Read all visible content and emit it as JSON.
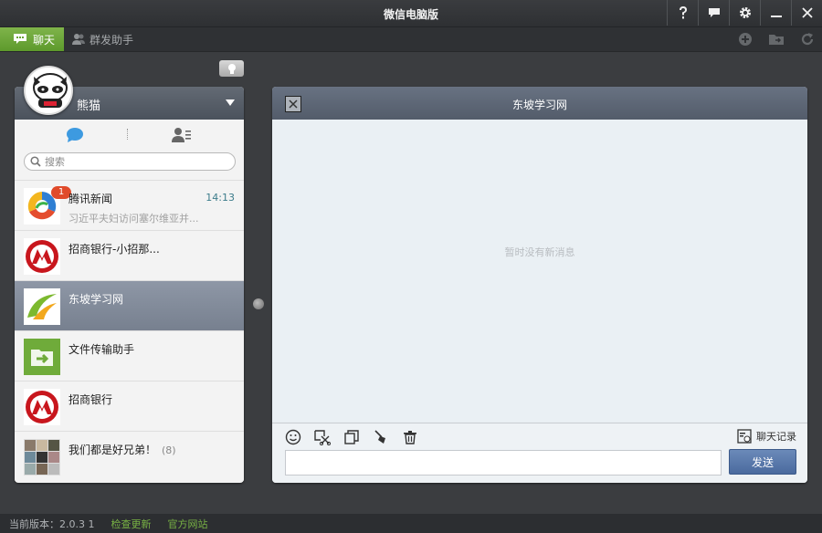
{
  "window": {
    "title": "微信电脑版"
  },
  "toolbar": {
    "chat_tab": "聊天",
    "mass_tab": "群发助手"
  },
  "profile": {
    "name": "熊猫"
  },
  "search": {
    "placeholder": "搜索"
  },
  "contacts": [
    {
      "name": "腾讯新闻",
      "preview": "习近平夫妇访问塞尔维亚并...",
      "time": "14:13",
      "badge": "1"
    },
    {
      "name": "招商银行-小招那...",
      "preview": "",
      "time": ""
    },
    {
      "name": "东坡学习网",
      "preview": "",
      "time": ""
    },
    {
      "name": "文件传输助手",
      "preview": "",
      "time": ""
    },
    {
      "name": "招商银行",
      "preview": "",
      "time": ""
    },
    {
      "name": "我们都是好兄弟！",
      "count": "(8)"
    }
  ],
  "chat": {
    "title": "东坡学习网",
    "empty_message": "暂时没有新消息",
    "history_label": "聊天记录",
    "send_label": "发送"
  },
  "status": {
    "version": "当前版本：2.0.3 1",
    "check_update": "检查更新",
    "official_site": "官方网站"
  },
  "colors": {
    "accent_green": "#6aa435",
    "selected_row": "#7f8898",
    "send_button": "#5a78a9",
    "badge_red": "#e04a2a"
  }
}
